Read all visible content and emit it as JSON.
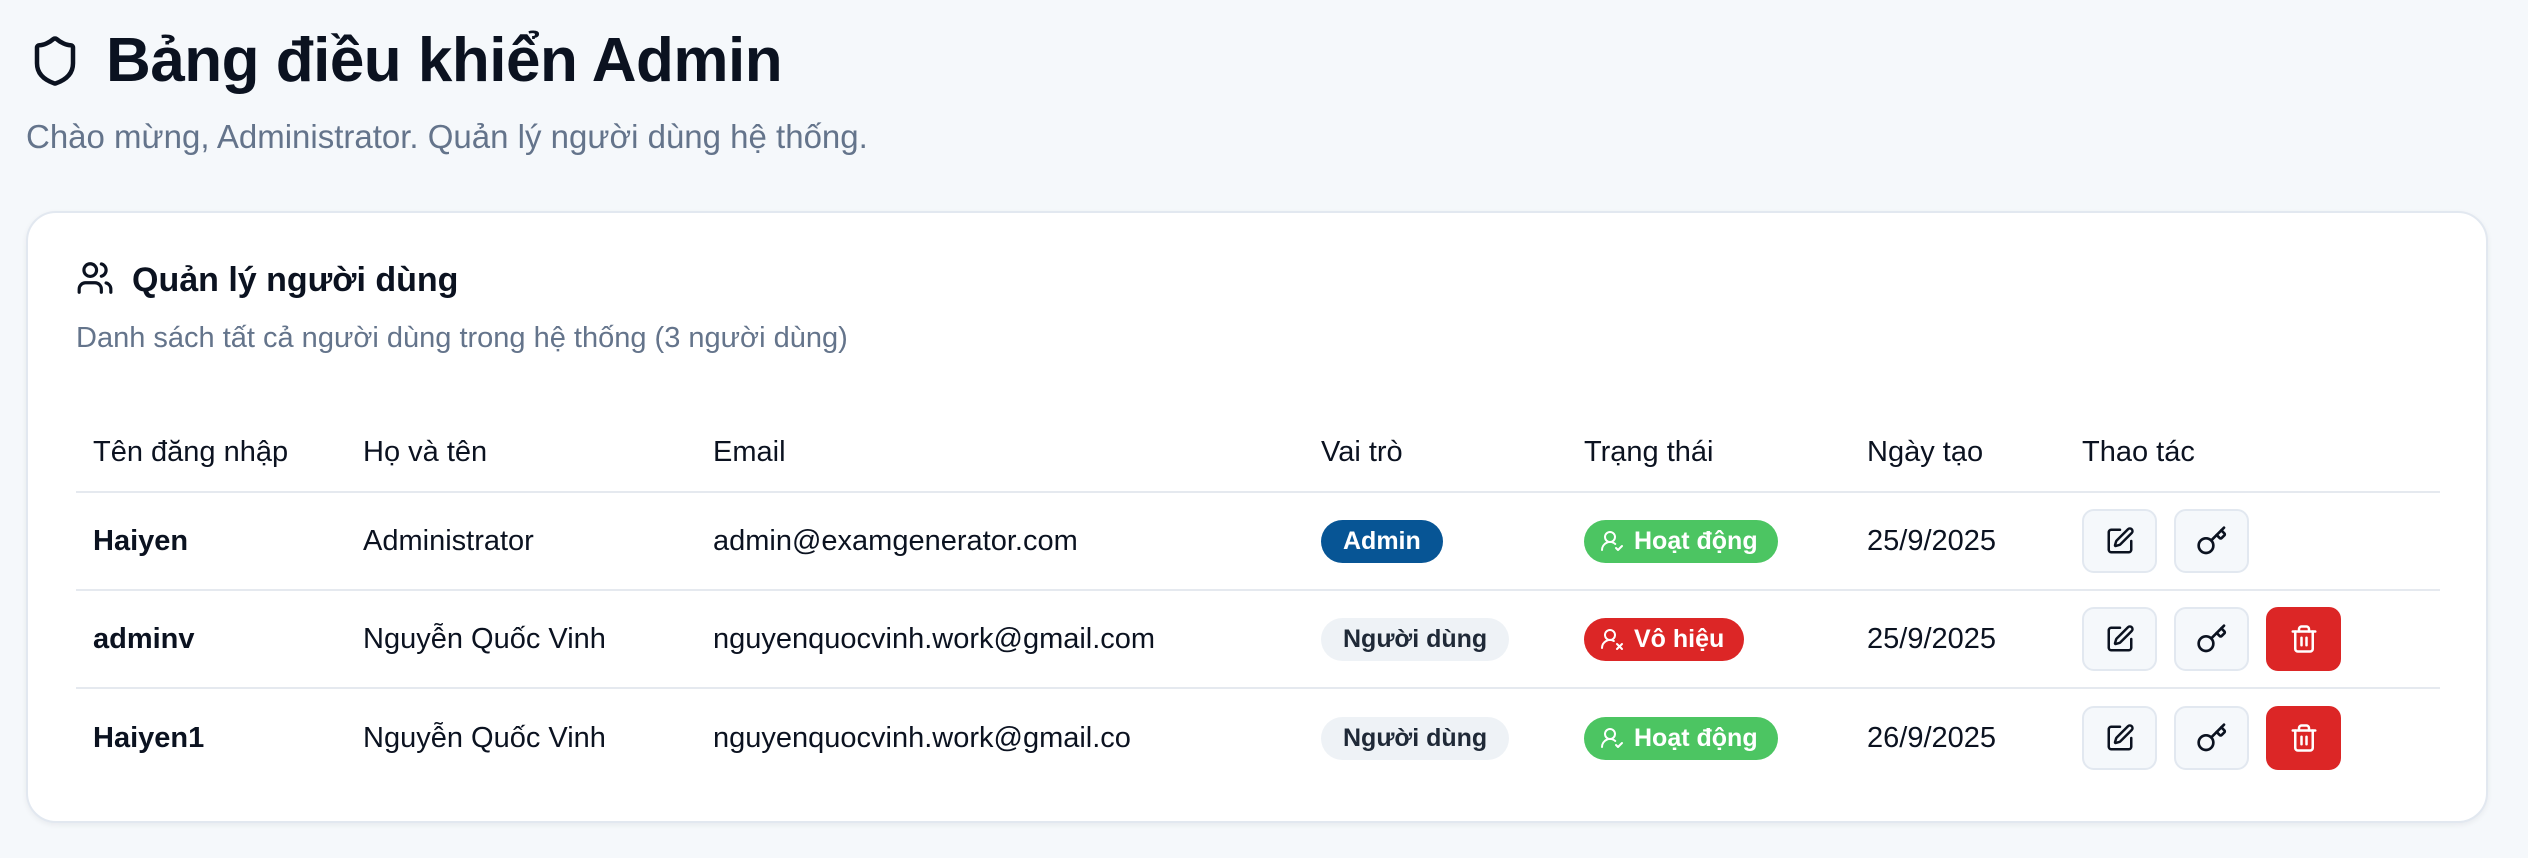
{
  "header": {
    "title": "Bảng điều khiển Admin",
    "subtitle": "Chào mừng, Administrator. Quản lý người dùng hệ thống.",
    "icon": "shield-icon"
  },
  "card": {
    "title": "Quản lý người dùng",
    "description": "Danh sách tất cả người dùng trong hệ thống (3 người dùng)",
    "icon": "users-icon"
  },
  "table": {
    "columns": [
      "Tên đăng nhập",
      "Họ và tên",
      "Email",
      "Vai trò",
      "Trạng thái",
      "Ngày tạo",
      "Thao tác"
    ],
    "rows": [
      {
        "username": "Haiyen",
        "fullname": "Administrator",
        "email": "admin@examgenerator.com",
        "role": "Admin",
        "role_type": "admin",
        "status": "Hoạt động",
        "status_type": "active",
        "created": "25/9/2025",
        "can_delete": false
      },
      {
        "username": "adminv",
        "fullname": "Nguyễn Quốc Vinh",
        "email": "nguyenquocvinh.work@gmail.com",
        "role": "Người dùng",
        "role_type": "user",
        "status": "Vô hiệu",
        "status_type": "disabled",
        "created": "25/9/2025",
        "can_delete": true
      },
      {
        "username": "Haiyen1",
        "fullname": "Nguyễn Quốc Vinh",
        "email": "nguyenquocvinh.work@gmail.co",
        "role": "Người dùng",
        "role_type": "user",
        "status": "Hoạt động",
        "status_type": "active",
        "created": "26/9/2025",
        "can_delete": true
      }
    ]
  },
  "colors": {
    "background": "#f5f8fb",
    "admin_badge": "#075595",
    "active_badge": "#4cc562",
    "disabled_badge": "#dc2626",
    "delete_button": "#dc2626"
  }
}
